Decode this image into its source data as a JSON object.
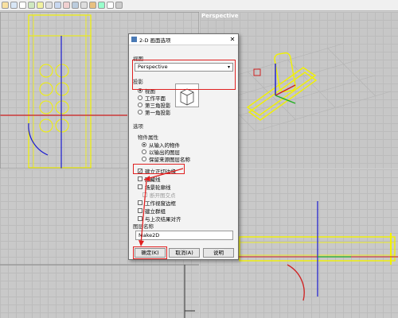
{
  "toolbar": {
    "icon_count": 14
  },
  "viewports": {
    "perspective_title": "Perspective"
  },
  "dialog": {
    "title": "2-D 画面选项",
    "close_glyph": "✕",
    "view_section": "视图",
    "view_value": "Perspective",
    "projection_section": "投影",
    "projections": [
      "视图",
      "工作平面",
      "第三角投影",
      "第一角投影"
    ],
    "options_section": "选项",
    "object_props_label": "物件属性",
    "object_props": [
      "从输入的物件",
      "以输出的图层",
      "保留来源图层名称"
    ],
    "checks": [
      {
        "label": "建立正切边缘",
        "checked": true
      },
      {
        "label": "隐藏线",
        "checked": false
      },
      {
        "label": "场景轮廓线",
        "checked": false
      },
      {
        "label": "断开图交点",
        "checked": false
      },
      {
        "label": "工作视窗边框",
        "checked": false
      },
      {
        "label": "建立群组",
        "checked": false
      },
      {
        "label": "与上次结果对齐",
        "checked": false
      }
    ],
    "layer_name_label": "图层名称",
    "layer_name_value": "Make2D",
    "ok_label": "确定(K)",
    "cancel_label": "取消(A)",
    "help_label": "说明"
  }
}
